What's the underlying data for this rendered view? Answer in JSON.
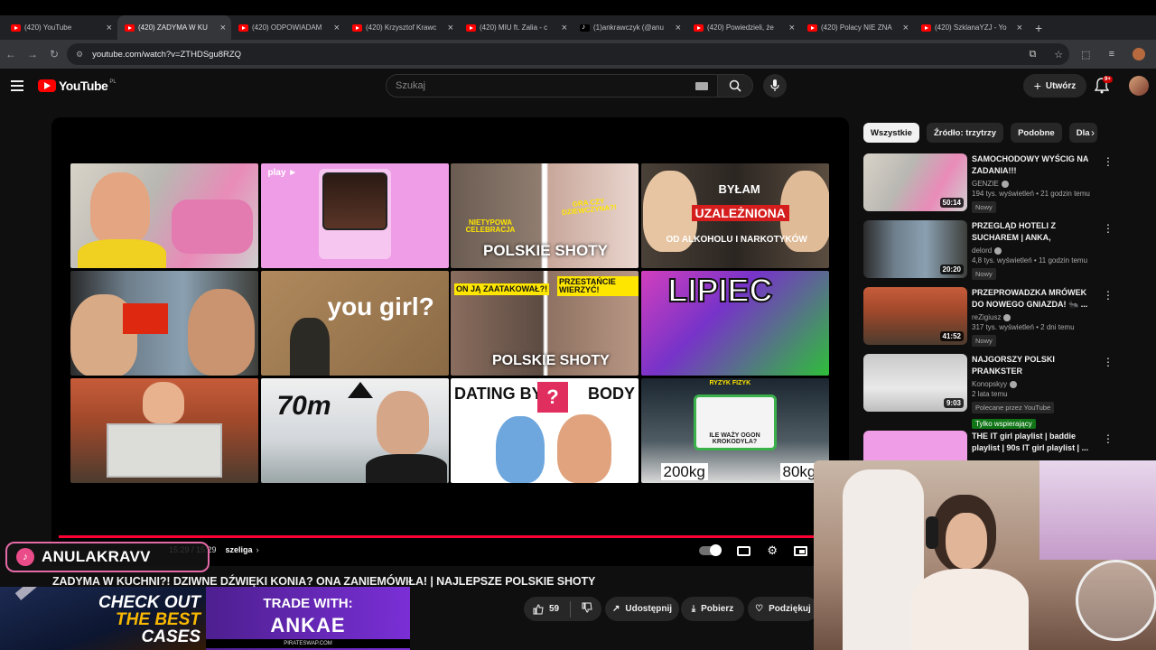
{
  "browser": {
    "tabs": [
      {
        "label": "(420) YouTube",
        "icon": "youtube-icon",
        "active": false
      },
      {
        "label": "(420) ZADYMA W KU",
        "icon": "youtube-icon",
        "active": true
      },
      {
        "label": "(420) ODPOWIADAM",
        "icon": "youtube-icon",
        "active": false
      },
      {
        "label": "(420) Krzysztof Krawc",
        "icon": "youtube-icon",
        "active": false
      },
      {
        "label": "(420) MIU ft. Zalia - c",
        "icon": "youtube-icon",
        "active": false
      },
      {
        "label": "(1)ankrawczyk (@anu",
        "icon": "tiktok-icon",
        "active": false
      },
      {
        "label": "(420) Powiedzieli, że",
        "icon": "youtube-icon",
        "active": false
      },
      {
        "label": "(420) Polacy NIE ZNA",
        "icon": "youtube-icon",
        "active": false
      },
      {
        "label": "(420) SzklanaYZJ - Yo",
        "icon": "youtube-icon",
        "active": false
      }
    ],
    "url": "youtube.com/watch?v=ZTHDSgu8RZQ"
  },
  "yt": {
    "logo": "YouTube",
    "region": "PL",
    "search_placeholder": "Szukaj",
    "create_label": "Utwórz",
    "notif_count": "9+"
  },
  "player": {
    "time": "15:29 / 15:29",
    "chapter": "szeliga",
    "tiles": [
      {
        "text": ""
      },
      {
        "text": "play ►"
      },
      {
        "text": "NIETYPOWA CELEBRACJA",
        "text2": "GRA CZY DZIEWCZYNA?!",
        "text3": "POLSKIE SHOTY"
      },
      {
        "text": "BYŁAM",
        "text2": "UZALEŻNIONA",
        "text3": "OD ALKOHOLU I NARKOTYKÓW"
      },
      {
        "text": ""
      },
      {
        "text": "you girl?"
      },
      {
        "text": "ON JĄ ZAATAKOWAŁ?!",
        "text2": "PRZESTAŃCIE WIERZYĆ!",
        "text3": "POLSKIE SHOTY"
      },
      {
        "text": "LIPIEC"
      },
      {
        "text": ""
      },
      {
        "text": "70m"
      },
      {
        "text": "DATING BY",
        "text2": "BODY"
      },
      {
        "text": "RYZYK FIZYK",
        "text2": "ILE WAŻY OGON KROKODYLA?",
        "text3": "200kg",
        "text4": "80kg"
      }
    ]
  },
  "video": {
    "title": "ZADYMA W KUCHNI?! DZIWNE DŹWIĘKI KONIA? ONA ZANIEMÓWIŁA! | NAJLEPSZE POLSKIE SHOTY",
    "likes": "59",
    "share": "Udostępnij",
    "download": "Pobierz",
    "thanks": "Podziękuj"
  },
  "sidebar": {
    "chips": [
      "Wszystkie",
      "Źródło: trzytrzy",
      "Podobne",
      "Dla"
    ],
    "items": [
      {
        "title": "SAMOCHODOWY WYŚCIG NA ZADANIA!!!",
        "channel": "GENZIE",
        "meta": "194 tys. wyświetleń • 21 godzin temu",
        "badge": "Nowy",
        "duration": "50:14"
      },
      {
        "title": "PRZEGLĄD HOTELI Z SUCHAREM | ANKA, CINKROF,...",
        "channel": "delord",
        "meta": "4,8 tys. wyświetleń • 11 godzin temu",
        "badge": "Nowy",
        "duration": "20:20"
      },
      {
        "title": "PRZEPROWADZKA MRÓWEK DO NOWEGO GNIAZDA! 🐜 ...",
        "channel": "reZigiusz",
        "meta": "317 tys. wyświetleń • 2 dni temu",
        "badge": "Nowy",
        "duration": "41:52"
      },
      {
        "title": "NAJGORSZY POLSKI PRANKSTER",
        "channel": "Konopskyy",
        "meta": "2 lata temu",
        "badge": "Polecane przez YouTube",
        "members": "Tylko wspierający",
        "duration": "9:03"
      },
      {
        "title": "THE IT girl playlist | baddie playlist | 90s IT girl playlist | ...",
        "channel": "",
        "meta": "",
        "badge": "",
        "duration": ""
      }
    ]
  },
  "overlay": {
    "tiktok_name": "ANULAKRAVV",
    "ad_left_line1": "CHECK OUT",
    "ad_left_line2": "THE BEST",
    "ad_left_line3": "CASES",
    "ad_right_line1": "TRADE WITH:",
    "ad_right_line2": "ANKAE",
    "ad_right_line3": "PIRATESWAP.COM"
  }
}
